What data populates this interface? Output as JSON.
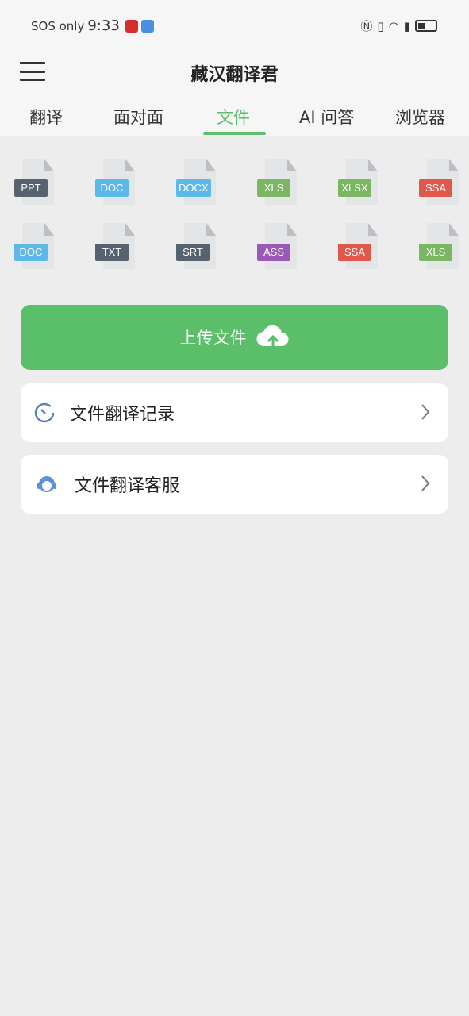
{
  "status": {
    "carrier": "SOS only",
    "time": "9:33"
  },
  "header": {
    "title": "藏汉翻译君"
  },
  "tabs": [
    {
      "label": "翻译"
    },
    {
      "label": "面对面"
    },
    {
      "label": "文件",
      "active": true
    },
    {
      "label": "AI 问答"
    },
    {
      "label": "浏览器"
    }
  ],
  "file_types": {
    "row1": [
      {
        "label": "PPT",
        "color": "#56626f"
      },
      {
        "label": "DOC",
        "color": "#5cb8e6"
      },
      {
        "label": "DOCX",
        "color": "#5cb8e6"
      },
      {
        "label": "XLS",
        "color": "#7bb662"
      },
      {
        "label": "XLSX",
        "color": "#7bb662"
      },
      {
        "label": "SSA",
        "color": "#e2574c"
      }
    ],
    "row2": [
      {
        "label": "DOC",
        "color": "#5cb8e6"
      },
      {
        "label": "TXT",
        "color": "#56626f"
      },
      {
        "label": "SRT",
        "color": "#56626f"
      },
      {
        "label": "ASS",
        "color": "#9b59b6"
      },
      {
        "label": "SSA",
        "color": "#e2574c"
      },
      {
        "label": "XLS",
        "color": "#7bb662"
      }
    ]
  },
  "upload": {
    "label": "上传文件",
    "icon": "cloud-upload-icon"
  },
  "menu": [
    {
      "label": "文件翻译记录",
      "icon": "timer-icon"
    },
    {
      "label": "文件翻译客服",
      "icon": "headset-icon"
    }
  ],
  "colors": {
    "accent": "#5bbf6a",
    "background": "#ededed"
  }
}
